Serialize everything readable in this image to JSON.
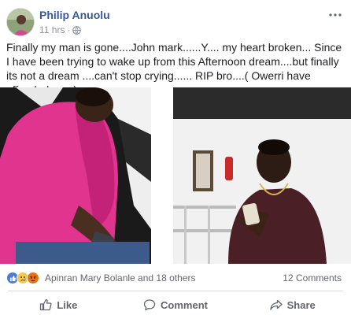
{
  "post": {
    "author": "Philip Anuolu",
    "time": "11 hrs",
    "separator": "·",
    "text": "Finally my man is gone....John mark......Y.... my heart broken... Since I have been trying to wake up from this Afternoon dream....but finally its not a dream ....can't stop crying...... RIP bro....( Owerri have offended me..)"
  },
  "engagement": {
    "reaction_icons": [
      "like-icon",
      "sad-icon",
      "angry-icon"
    ],
    "reactions_text": "Apinran Mary Bolanle and 18 others",
    "comments_text": "12 Comments"
  },
  "actions": {
    "like_label": "Like",
    "comment_label": "Comment",
    "share_label": "Share"
  },
  "colors": {
    "author": "#385898",
    "muted": "#606770",
    "like_blue": "#4a7bd9"
  }
}
